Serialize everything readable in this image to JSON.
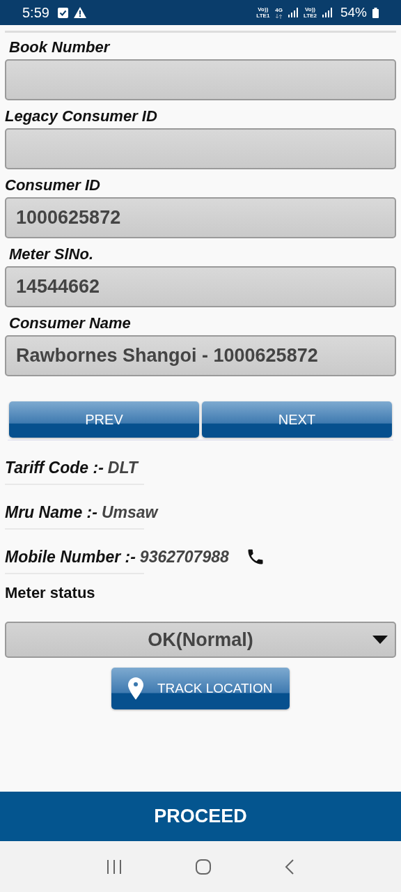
{
  "status_bar": {
    "time": "5:59",
    "sim1": [
      "Vo))",
      "LTE1"
    ],
    "network": "4G",
    "sim2": [
      "Vo))",
      "LTE2"
    ],
    "battery": "54%"
  },
  "fields": [
    {
      "label": "Book Number"
    },
    {
      "label": "Legacy Consumer ID"
    },
    {
      "label": "Consumer ID",
      "value": "1000625872"
    },
    {
      "label": "Meter SlNo.",
      "value": "14544662"
    },
    {
      "label": "Consumer Name",
      "value": "Rawbornes Shangoi - 1000625872"
    }
  ],
  "nav_buttons": [
    "PREV",
    "NEXT"
  ],
  "info": [
    {
      "label": "Tariff Code :-",
      "value": "DLT",
      "call": false
    },
    {
      "label": "Mru Name :-",
      "value": "Umsaw",
      "call": false
    },
    {
      "label": "Mobile Number :-",
      "value": "9362707988",
      "call": true
    }
  ],
  "meter_status": {
    "label": "Meter status",
    "value": "OK(Normal)"
  },
  "track_button": "TRACK LOCATION",
  "proceed_button": "PROCEED"
}
